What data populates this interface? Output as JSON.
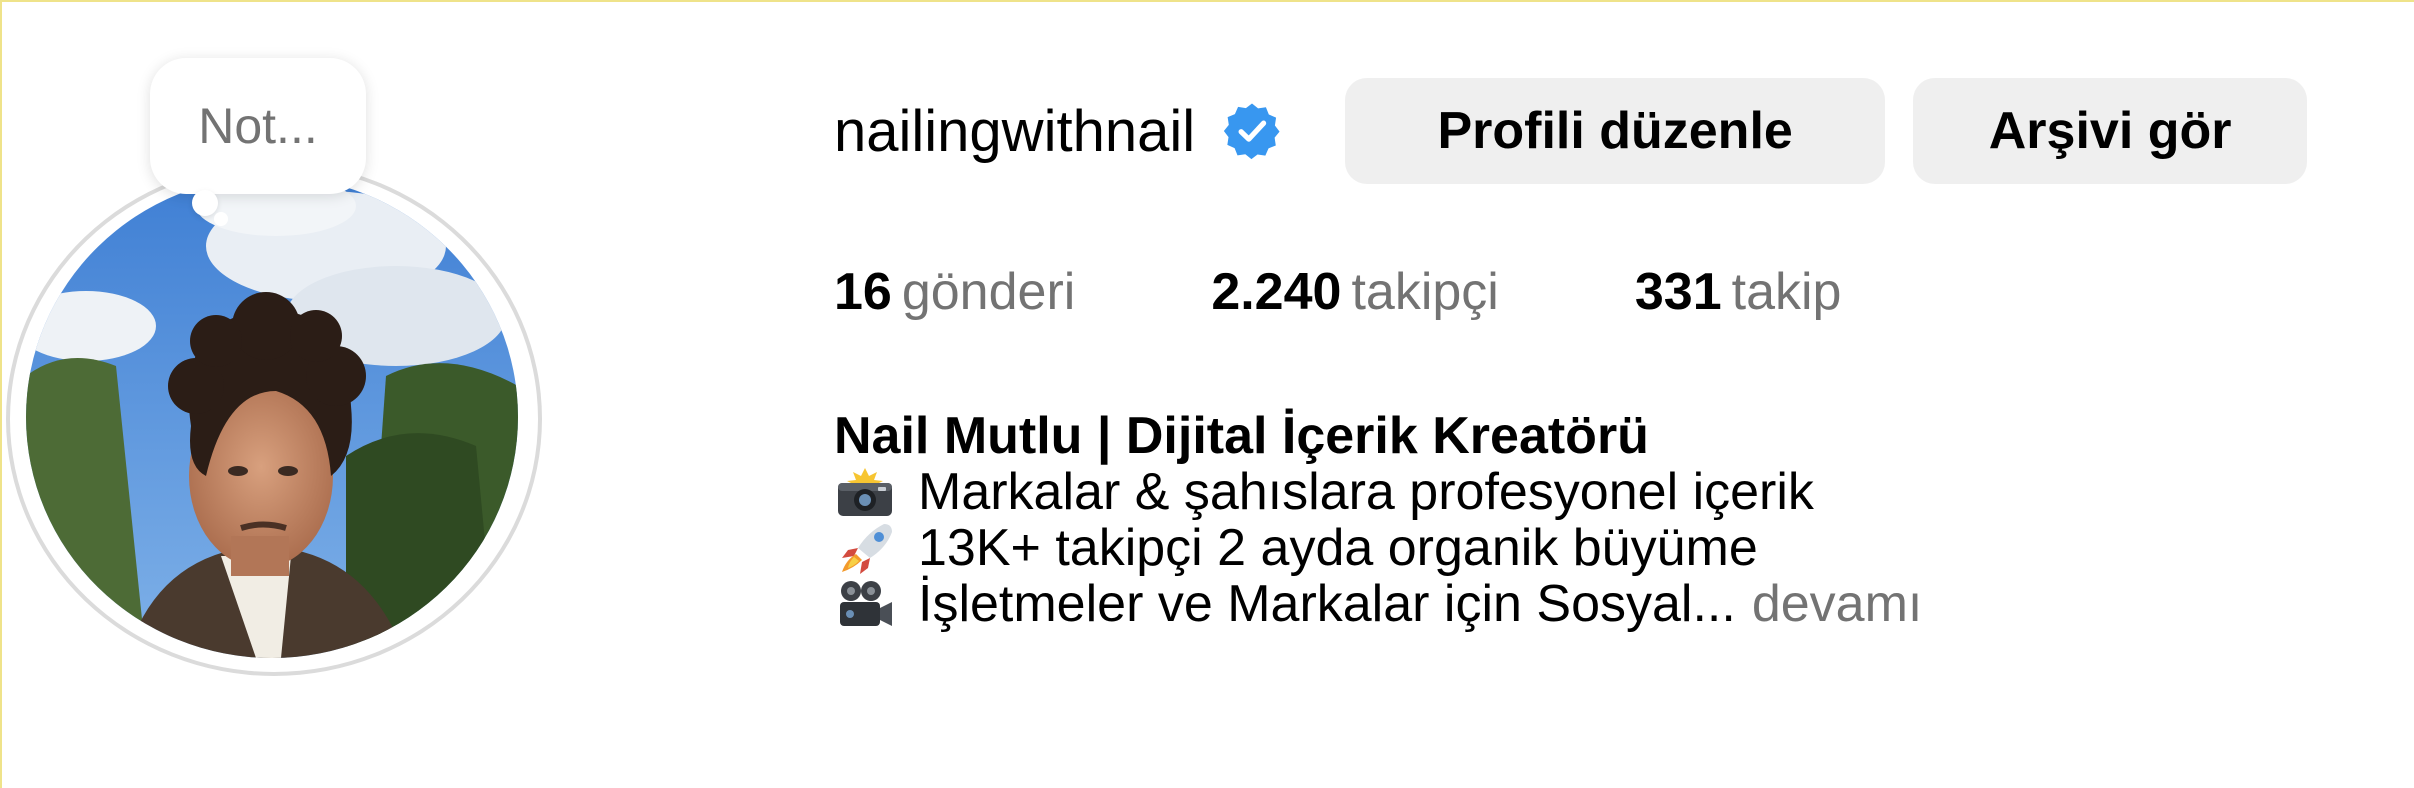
{
  "profile": {
    "note_placeholder": "Not...",
    "username": "nailingwithnail",
    "verified": true,
    "buttons": {
      "edit_profile": "Profili düzenle",
      "view_archive": "Arşivi gör"
    },
    "stats": [
      {
        "value": "16",
        "label": "gönderi"
      },
      {
        "value": "2.240",
        "label": "takipçi"
      },
      {
        "value": "331",
        "label": "takip"
      }
    ],
    "bio": {
      "name": "Nail Mutlu | Dijital İçerik Kreatörü",
      "lines": [
        {
          "icon": "camera-flash-icon",
          "text": "Markalar & şahıslara profesyonel içerik"
        },
        {
          "icon": "rocket-icon",
          "text": "13K+ takipçi 2 ayda organik büyüme"
        },
        {
          "icon": "movie-camera-icon",
          "text": "İşletmeler ve Markalar için Sosyal..."
        }
      ],
      "more_label": "devamı"
    }
  },
  "colors": {
    "verified_badge": "#3897f0",
    "button_bg": "#efefef",
    "secondary_text": "#737373",
    "avatar_ring": "#dbdbdb"
  }
}
